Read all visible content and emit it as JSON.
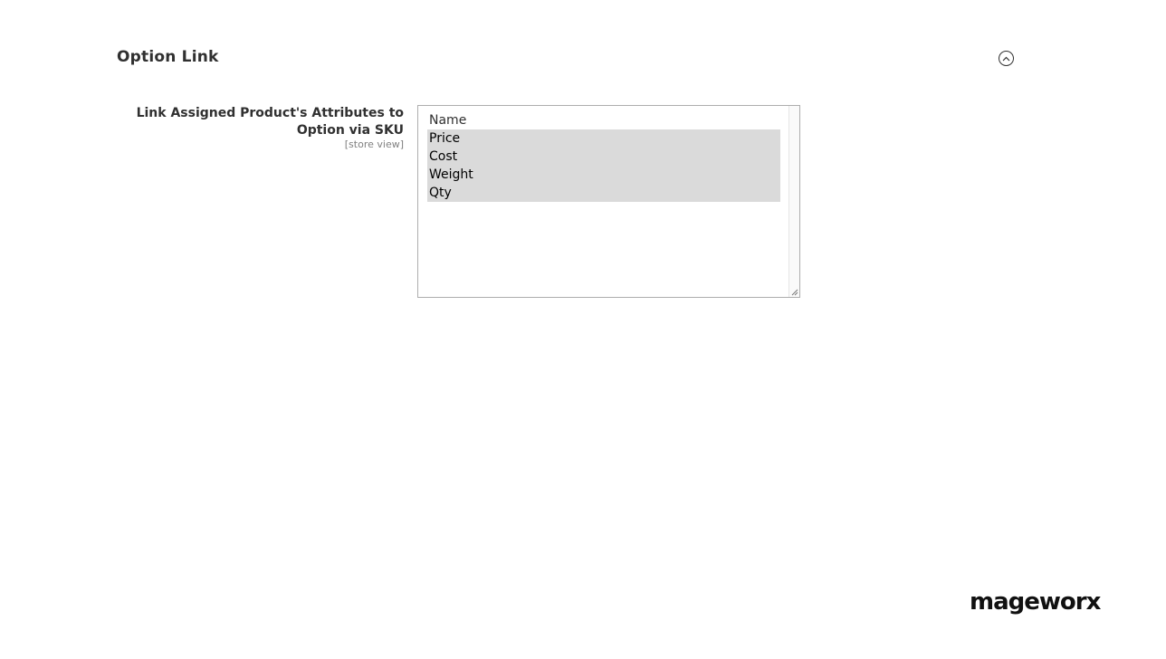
{
  "section": {
    "title": "Option Link"
  },
  "field": {
    "label": "Link Assigned Product's Attributes to Option via SKU",
    "scope": "[store view]",
    "options": [
      {
        "label": "Name",
        "selected": false
      },
      {
        "label": "Price",
        "selected": true
      },
      {
        "label": "Cost",
        "selected": true
      },
      {
        "label": "Weight",
        "selected": true
      },
      {
        "label": "Qty",
        "selected": true
      }
    ]
  },
  "brand": {
    "logo_text": "mageworx"
  },
  "icons": {
    "collapse": "chevron-up-circle-icon"
  },
  "colors": {
    "selected_bg": "#dadada",
    "text": "#303030",
    "border": "#adadad"
  }
}
